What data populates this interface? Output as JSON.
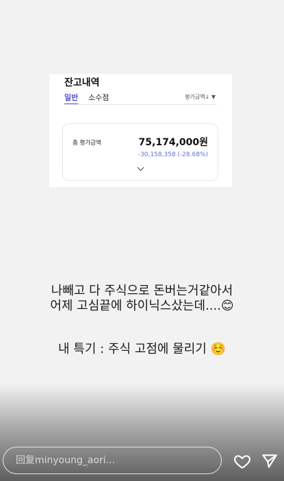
{
  "card": {
    "title": "잔고내역",
    "tab_general": "일반",
    "tab_decimal": "소수점",
    "sort_label": "평가금액↓ ▼",
    "total_label": "총 평가금액",
    "total_value": "75,174,000원",
    "total_change": "-30,158,358 (-28.68%)",
    "accent_color": "#5a4fd6",
    "change_color": "#5f6fd6"
  },
  "caption": {
    "line1": "나빼고 다 주식으로 돈버는거같아서",
    "line2": "어제 고심끝에 하이닉스샀는데....😊",
    "line3": "내 특기 : 주식 고점에 물리기 ☺️"
  },
  "reply": {
    "placeholder": "回复minyoung_aori..."
  },
  "icons": {
    "heart": "heart-icon",
    "send": "send-icon",
    "chevron": "chevron-down-icon"
  }
}
